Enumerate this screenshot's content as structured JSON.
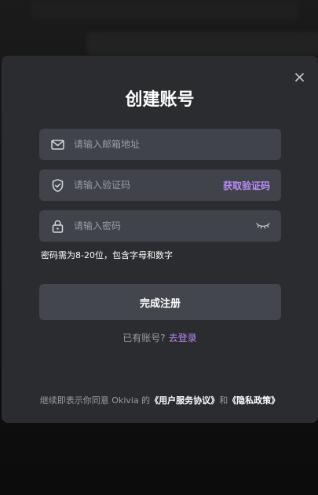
{
  "modal": {
    "title": "创建账号",
    "email": {
      "placeholder": "请输入邮箱地址",
      "icon": "mail-icon"
    },
    "code": {
      "placeholder": "请输入验证码",
      "icon": "shield-icon",
      "action_label": "获取验证码"
    },
    "password": {
      "placeholder": "请输入密码",
      "icon": "lock-icon",
      "toggle_icon": "eye-closed-icon"
    },
    "password_hint": "密码需为8-20位，包含字母和数字",
    "submit_label": "完成注册",
    "login_prompt": "已有账号?",
    "login_link": "去登录",
    "terms": {
      "prefix": "继续即表示你同意 Okivia 的",
      "user_agreement": "《用户服务协议》",
      "conjunction": "和",
      "privacy_policy": "《隐私政策》"
    }
  },
  "colors": {
    "accent": "#b78cf5",
    "modal_bg": "#2a2c30",
    "field_bg": "#40434a",
    "text_muted": "#9a9da3"
  }
}
